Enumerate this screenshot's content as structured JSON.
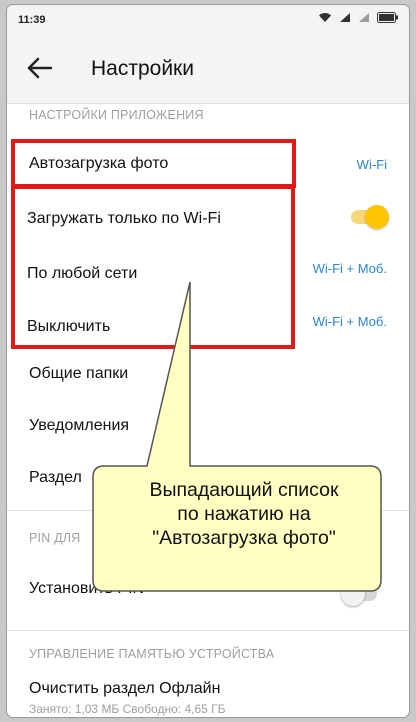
{
  "statusbar": {
    "time": "11:39"
  },
  "toolbar": {
    "title": "Настройки"
  },
  "sections": {
    "app_settings": "НАСТРОЙКИ ПРИЛОЖЕНИЯ",
    "pin": "PIN ДЛЯ",
    "storage": "УПРАВЛЕНИЕ ПАМЯТЬЮ УСТРОЙСТВА"
  },
  "rows": {
    "autoupload": {
      "label": "Автозагрузка фото",
      "value": "Wi-Fi"
    },
    "video_value": "Wi-Fi + Моб.",
    "traffic_value": "Wi-Fi + Моб.",
    "shared_folders": "Общие папки",
    "notifications": "Уведомления",
    "section_partial": "Раздел",
    "set_pin": "Установить PIN",
    "clear_offline": "Очистить раздел Офлайн",
    "clear_offline_sub": "Занято: 1,03 МБ Свободно: 4,65 ГБ"
  },
  "toggles": {
    "wifi_only": true,
    "pin": false
  },
  "dropdown": {
    "items": [
      "Загружать только по Wi-Fi",
      "По любой сети",
      "Выключить"
    ]
  },
  "callout": {
    "lines": [
      "Выпадающий список",
      "по нажатию на",
      "\"Автозагрузка фото\""
    ]
  },
  "colors": {
    "accent": "#2a86d6",
    "highlight": "#e01919",
    "toggle_on": "#ffc500",
    "callout_fill": "#ffffc2"
  }
}
